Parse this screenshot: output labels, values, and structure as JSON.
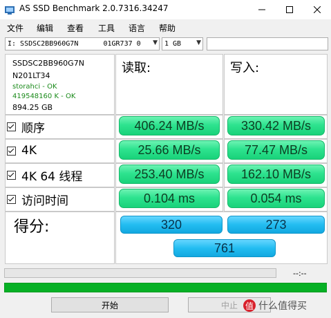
{
  "window": {
    "title": "AS SSD Benchmark 2.0.7316.34247"
  },
  "menu": {
    "items": [
      "文件",
      "编辑",
      "查看",
      "工具",
      "语言",
      "帮助"
    ]
  },
  "toolbar": {
    "drive_select": "I: SSDSC2BB960G7N      01GR737 0",
    "size_select": "1 GB",
    "extra_field": ""
  },
  "drive_info": {
    "model": "SSDSC2BB960G7N",
    "firmware": "N201LT34",
    "driver": "storahci - OK",
    "alignment": "419548160 K - OK",
    "capacity": "894.25 GB"
  },
  "columns": {
    "read": "读取:",
    "write": "写入:"
  },
  "tests": [
    {
      "label": "顺序",
      "read": "406.24 MB/s",
      "write": "330.42 MB/s"
    },
    {
      "label": "4K",
      "read": "25.66 MB/s",
      "write": "77.47 MB/s"
    },
    {
      "label": "4K 64 线程",
      "read": "253.40 MB/s",
      "write": "162.10 MB/s"
    },
    {
      "label": "访问时间",
      "read": "0.104 ms",
      "write": "0.054 ms"
    }
  ],
  "score": {
    "label": "得分:",
    "read": "320",
    "write": "273",
    "total": "761"
  },
  "status": {
    "elapsed": "--:--",
    "progress_fraction": 1.0
  },
  "buttons": {
    "start": "开始",
    "abort": "中止"
  },
  "watermark": {
    "badge": "值",
    "text": "什么值得买"
  },
  "colors": {
    "result_green": "#2ee38f",
    "score_blue": "#23bdf1",
    "progress_green": "#06b025",
    "ok_text": "#1a8a1a"
  }
}
